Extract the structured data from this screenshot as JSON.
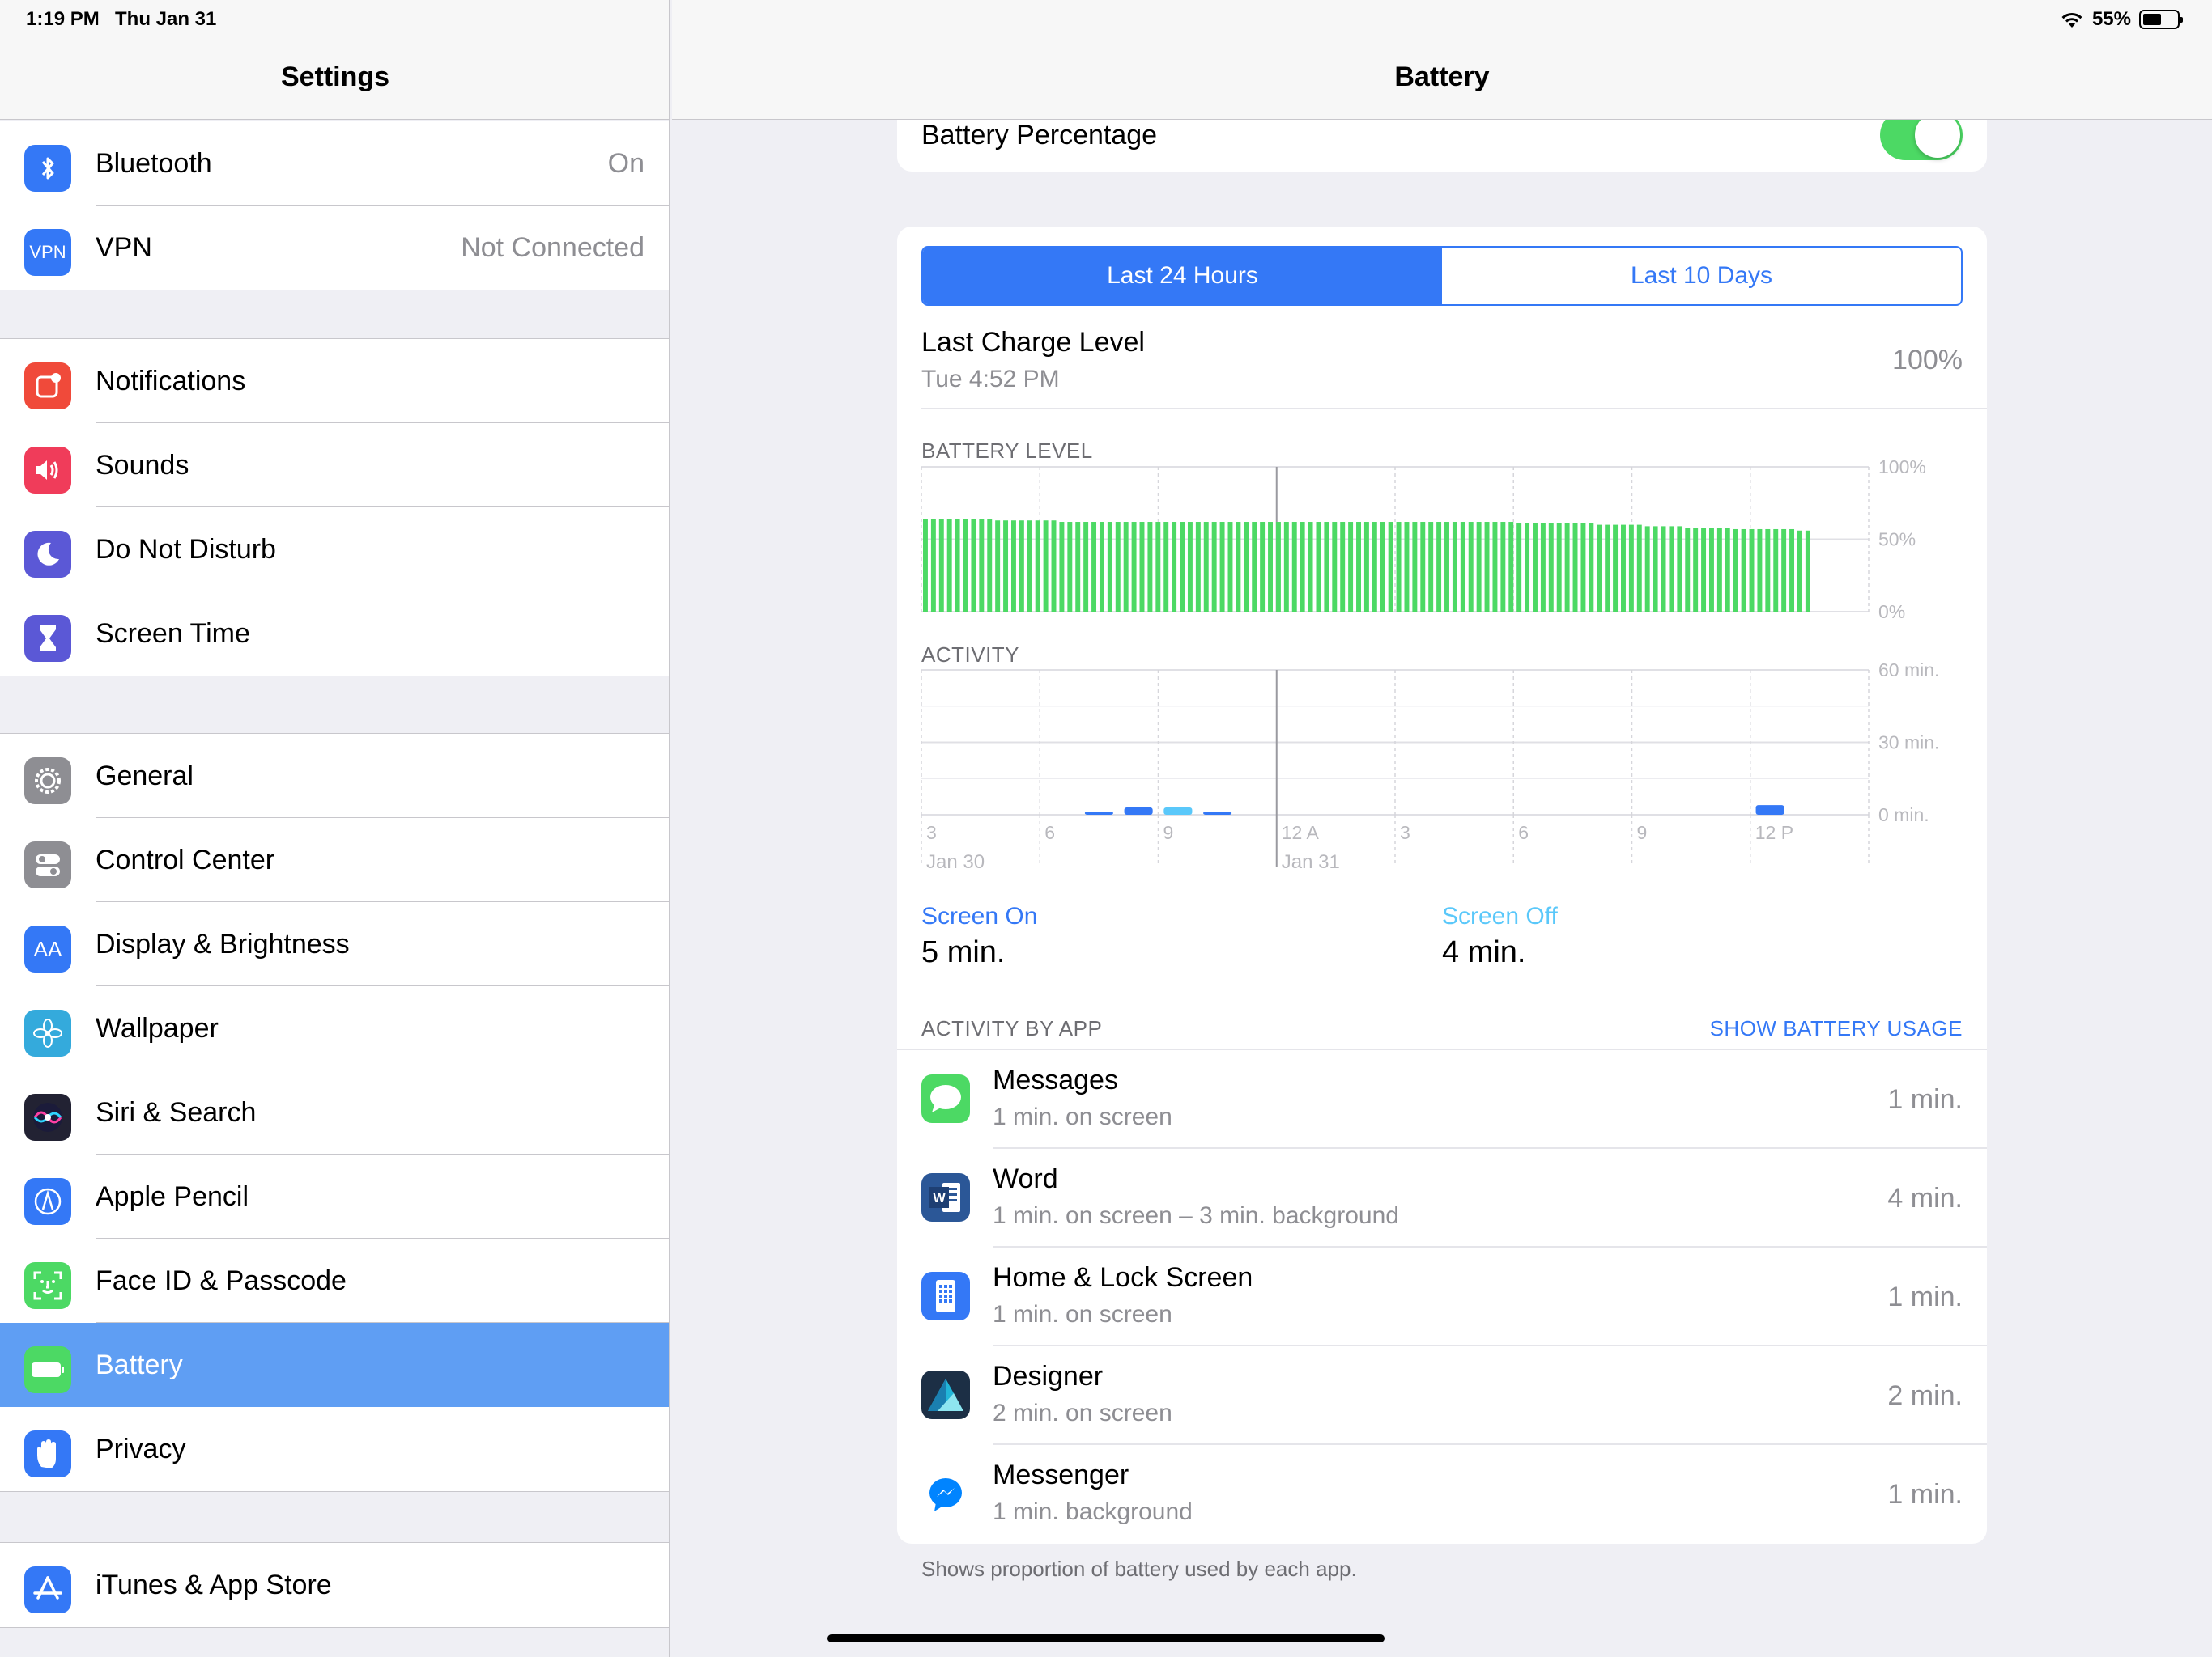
{
  "status_bar": {
    "time": "1:19 PM",
    "date": "Thu Jan 31",
    "battery_text": "55%",
    "battery_level": 0.55
  },
  "sidebar": {
    "title": "Settings",
    "groups": [
      [
        {
          "label": "Bluetooth",
          "value": "On",
          "icon": "bluetooth-icon",
          "color": "#3478f6"
        },
        {
          "label": "VPN",
          "value": "Not Connected",
          "icon": "vpn-icon",
          "color": "#3478f6",
          "icon_text": "VPN"
        }
      ],
      [
        {
          "label": "Notifications",
          "icon": "notifications-icon",
          "color": "#f04a3a"
        },
        {
          "label": "Sounds",
          "icon": "sounds-icon",
          "color": "#f03c5a"
        },
        {
          "label": "Do Not Disturb",
          "icon": "moon-icon",
          "color": "#5b58d6"
        },
        {
          "label": "Screen Time",
          "icon": "hourglass-icon",
          "color": "#5b58d6"
        }
      ],
      [
        {
          "label": "General",
          "icon": "gear-icon",
          "color": "#8e8e93"
        },
        {
          "label": "Control Center",
          "icon": "toggles-icon",
          "color": "#8e8e93"
        },
        {
          "label": "Display & Brightness",
          "icon": "display-icon",
          "color": "#3478f6",
          "icon_text": "AA"
        },
        {
          "label": "Wallpaper",
          "icon": "flower-icon",
          "color": "#34aadc"
        },
        {
          "label": "Siri & Search",
          "icon": "siri-icon",
          "color": "#222233"
        },
        {
          "label": "Apple Pencil",
          "icon": "pencil-icon",
          "color": "#3478f6"
        },
        {
          "label": "Face ID & Passcode",
          "icon": "face-id-icon",
          "color": "#4cd964"
        },
        {
          "label": "Battery",
          "icon": "battery-icon",
          "color": "#4cd964",
          "selected": true
        },
        {
          "label": "Privacy",
          "icon": "hand-icon",
          "color": "#3478f6"
        }
      ],
      [
        {
          "label": "iTunes & App Store",
          "icon": "app-store-icon",
          "color": "#3478f6"
        }
      ]
    ]
  },
  "detail": {
    "title": "Battery",
    "battery_percentage_label": "Battery Percentage",
    "battery_percentage_on": true,
    "segments": [
      "Last 24 Hours",
      "Last 10 Days"
    ],
    "active_segment": 0,
    "last_charge": {
      "title": "Last Charge Level",
      "time": "Tue 4:52 PM",
      "value": "100%"
    },
    "battery_level_label": "BATTERY LEVEL",
    "activity_label": "ACTIVITY",
    "screen_on": {
      "label": "Screen On",
      "value": "5 min.",
      "color": "#3478f6"
    },
    "screen_off": {
      "label": "Screen Off",
      "value": "4 min.",
      "color": "#5ac8fa"
    },
    "activity_by_app_label": "ACTIVITY BY APP",
    "show_battery_usage": "SHOW BATTERY USAGE",
    "apps": [
      {
        "name": "Messages",
        "sub": "1 min. on screen",
        "time": "1 min.",
        "icon": "messages-icon",
        "color": "#4cd964"
      },
      {
        "name": "Word",
        "sub": "1 min. on screen – 3 min. background",
        "time": "4 min.",
        "icon": "word-icon",
        "color": "#2b5797"
      },
      {
        "name": "Home & Lock Screen",
        "sub": "1 min. on screen",
        "time": "1 min.",
        "icon": "home-lock-icon",
        "color": "#3478f6"
      },
      {
        "name": "Designer",
        "sub": "2 min. on screen",
        "time": "2 min.",
        "icon": "designer-icon",
        "color": "#1c4f7c"
      },
      {
        "name": "Messenger",
        "sub": "1 min. background",
        "time": "1 min.",
        "icon": "messenger-icon",
        "color": "#0084ff"
      }
    ],
    "footnote": "Shows proportion of battery used by each app."
  },
  "chart_data": [
    {
      "type": "bar",
      "title": "BATTERY LEVEL",
      "ylabel": "",
      "ylim": [
        0,
        100
      ],
      "y_ticks": [
        "100%",
        "50%",
        "0%"
      ],
      "x_ticks": [
        "3",
        "6",
        "9",
        "12 A",
        "3",
        "6",
        "9",
        "12 P"
      ],
      "x_date_labels": [
        "Jan 30",
        "Jan 31"
      ],
      "bar_color": "#4cd964",
      "values": [
        64,
        64,
        64,
        64,
        64,
        64,
        64,
        64,
        64,
        63,
        63,
        63,
        63,
        63,
        63,
        63,
        63,
        62,
        62,
        62,
        62,
        62,
        62,
        62,
        62,
        62,
        62,
        62,
        62,
        62,
        62,
        62,
        62,
        62,
        62,
        62,
        62,
        62,
        62,
        62,
        62,
        62,
        62,
        62,
        62,
        62,
        62,
        62,
        62,
        62,
        62,
        62,
        62,
        62,
        62,
        62,
        62,
        62,
        62,
        62,
        62,
        62,
        62,
        62,
        62,
        62,
        62,
        62,
        62,
        62,
        62,
        62,
        62,
        62,
        61,
        61,
        61,
        61,
        61,
        61,
        61,
        61,
        61,
        61,
        60,
        60,
        60,
        60,
        60,
        60,
        59,
        59,
        59,
        59,
        59,
        58,
        58,
        58,
        58,
        58,
        58,
        57,
        57,
        57,
        57,
        57,
        57,
        57,
        57,
        56,
        56
      ]
    },
    {
      "type": "bar",
      "title": "ACTIVITY",
      "ylim": [
        0,
        60
      ],
      "y_ticks": [
        "60 min.",
        "30 min.",
        "0 min."
      ],
      "x_ticks": [
        "3",
        "6",
        "9",
        "12 A",
        "3",
        "6",
        "9",
        "12 P"
      ],
      "x_date_labels": [
        "Jan 30",
        "Jan 31"
      ],
      "series": [
        {
          "name": "Screen On",
          "color": "#3478f6",
          "bars": [
            {
              "x": 4.5,
              "value": 1
            },
            {
              "x": 5.5,
              "value": 3
            },
            {
              "x": 7.5,
              "value": 1
            },
            {
              "x": 21.5,
              "value": 4
            }
          ]
        },
        {
          "name": "Screen Off",
          "color": "#5ac8fa",
          "bars": [
            {
              "x": 6.5,
              "value": 3
            }
          ]
        }
      ]
    }
  ]
}
